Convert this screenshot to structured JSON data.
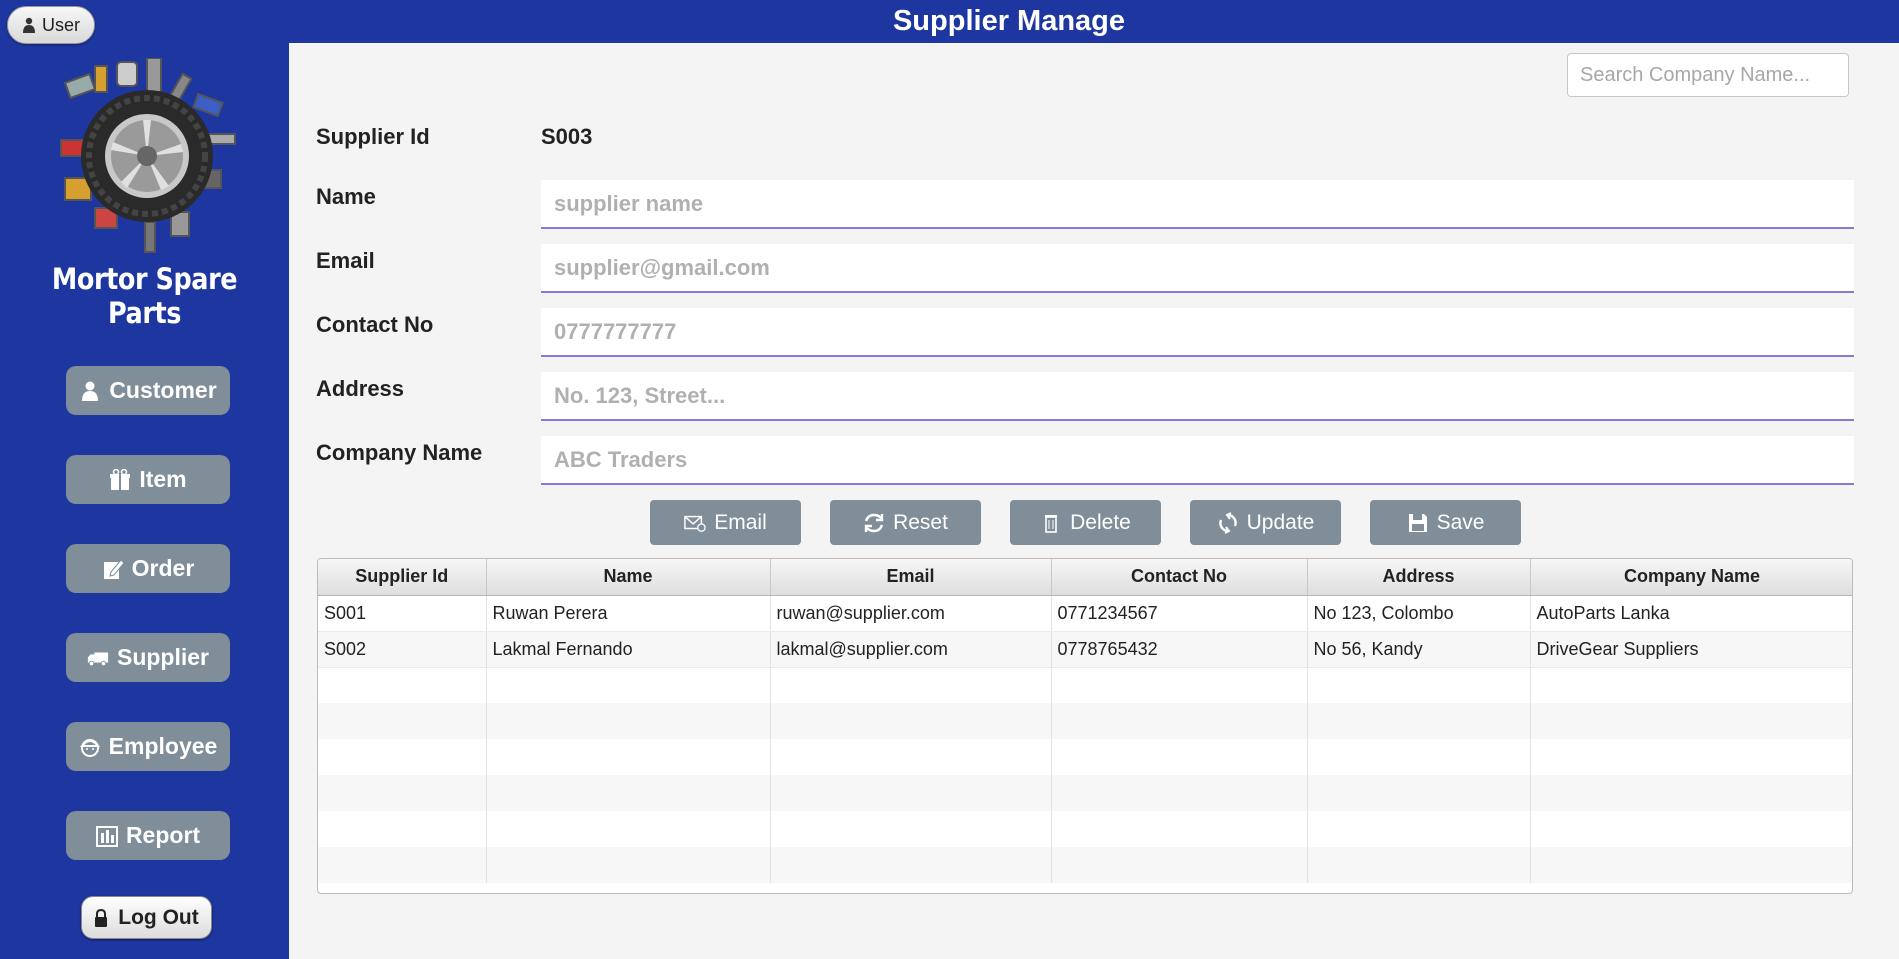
{
  "header": {
    "title": "Supplier Manage"
  },
  "user_button": {
    "label": "User",
    "icon": "person-icon"
  },
  "sidebar": {
    "brand": "Mortor Spare Parts",
    "logo": "car-parts-logo",
    "color": "#1e36a0",
    "items": [
      {
        "label": "Customer",
        "icon": "person-icon"
      },
      {
        "label": "Item",
        "icon": "gift-icon"
      },
      {
        "label": "Order",
        "icon": "edit-icon"
      },
      {
        "label": "Supplier",
        "icon": "truck-icon"
      },
      {
        "label": "Employee",
        "icon": "worker-icon"
      },
      {
        "label": "Report",
        "icon": "report-icon"
      }
    ],
    "logout": {
      "label": "Log Out",
      "icon": "lock-icon"
    }
  },
  "search": {
    "placeholder": "Search Company Name..."
  },
  "form": {
    "supplier_id_label": "Supplier Id",
    "supplier_id_value": "S003",
    "name_label": "Name",
    "name_placeholder": "supplier name",
    "email_label": "Email",
    "email_placeholder": "supplier@gmail.com",
    "contact_label": "Contact No",
    "contact_placeholder": "0777777777",
    "address_label": "Address",
    "address_placeholder": "No. 123, Street...",
    "company_label": "Company Name",
    "company_placeholder": "ABC Traders"
  },
  "actions": {
    "email": "Email",
    "reset": "Reset",
    "delete": "Delete",
    "update": "Update",
    "save": "Save",
    "button_color": "#7f8e99"
  },
  "table": {
    "columns": [
      "Supplier Id",
      "Name",
      "Email",
      "Contact No",
      "Address",
      "Company Name"
    ],
    "rows": [
      [
        "S001",
        "Ruwan Perera",
        "ruwan@supplier.com",
        "0771234567",
        "No 123, Colombo",
        "AutoParts Lanka"
      ],
      [
        "S002",
        "Lakmal Fernando",
        "lakmal@supplier.com",
        "0778765432",
        "No 56, Kandy",
        "DriveGear Suppliers"
      ]
    ]
  }
}
